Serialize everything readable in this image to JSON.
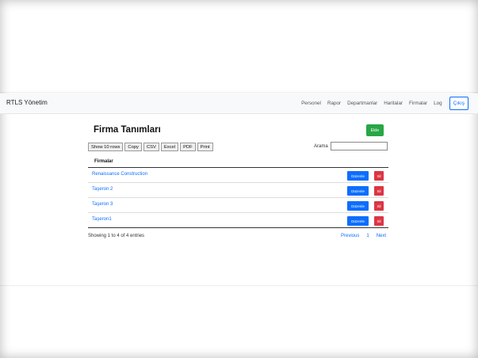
{
  "navbar": {
    "brand": "RTLS Yönetim",
    "links": [
      "Personel",
      "Rapor",
      "Departmanlar",
      "Haritalar",
      "Firmalar",
      "Log"
    ],
    "logout_label": "Çıkış"
  },
  "page": {
    "title": "Firma Tanımları",
    "add_label": "Ekle"
  },
  "toolbar": {
    "buttons": [
      "Show 10 rows",
      "Copy",
      "CSV",
      "Excel",
      "PDF",
      "Print"
    ],
    "search_label": "Arama",
    "search_value": ""
  },
  "table": {
    "header": "Firmalar",
    "rows": [
      {
        "name": "Renaissance Construction",
        "edit": "Düzenle",
        "delete": "Sil"
      },
      {
        "name": "Taşeron 2",
        "edit": "Düzenle",
        "delete": "Sil"
      },
      {
        "name": "Taşeron 3",
        "edit": "Düzenle",
        "delete": "Sil"
      },
      {
        "name": "Taşeron1",
        "edit": "Düzenle",
        "delete": "Sil"
      }
    ]
  },
  "footer": {
    "info": "Showing 1 to 4 of 4 entries",
    "prev": "Previous",
    "page": "1",
    "next": "Next"
  },
  "colors": {
    "primary": "#0d6efd",
    "success": "#28a745",
    "danger": "#dc3545",
    "navbar_bg": "#f8f9fa"
  }
}
